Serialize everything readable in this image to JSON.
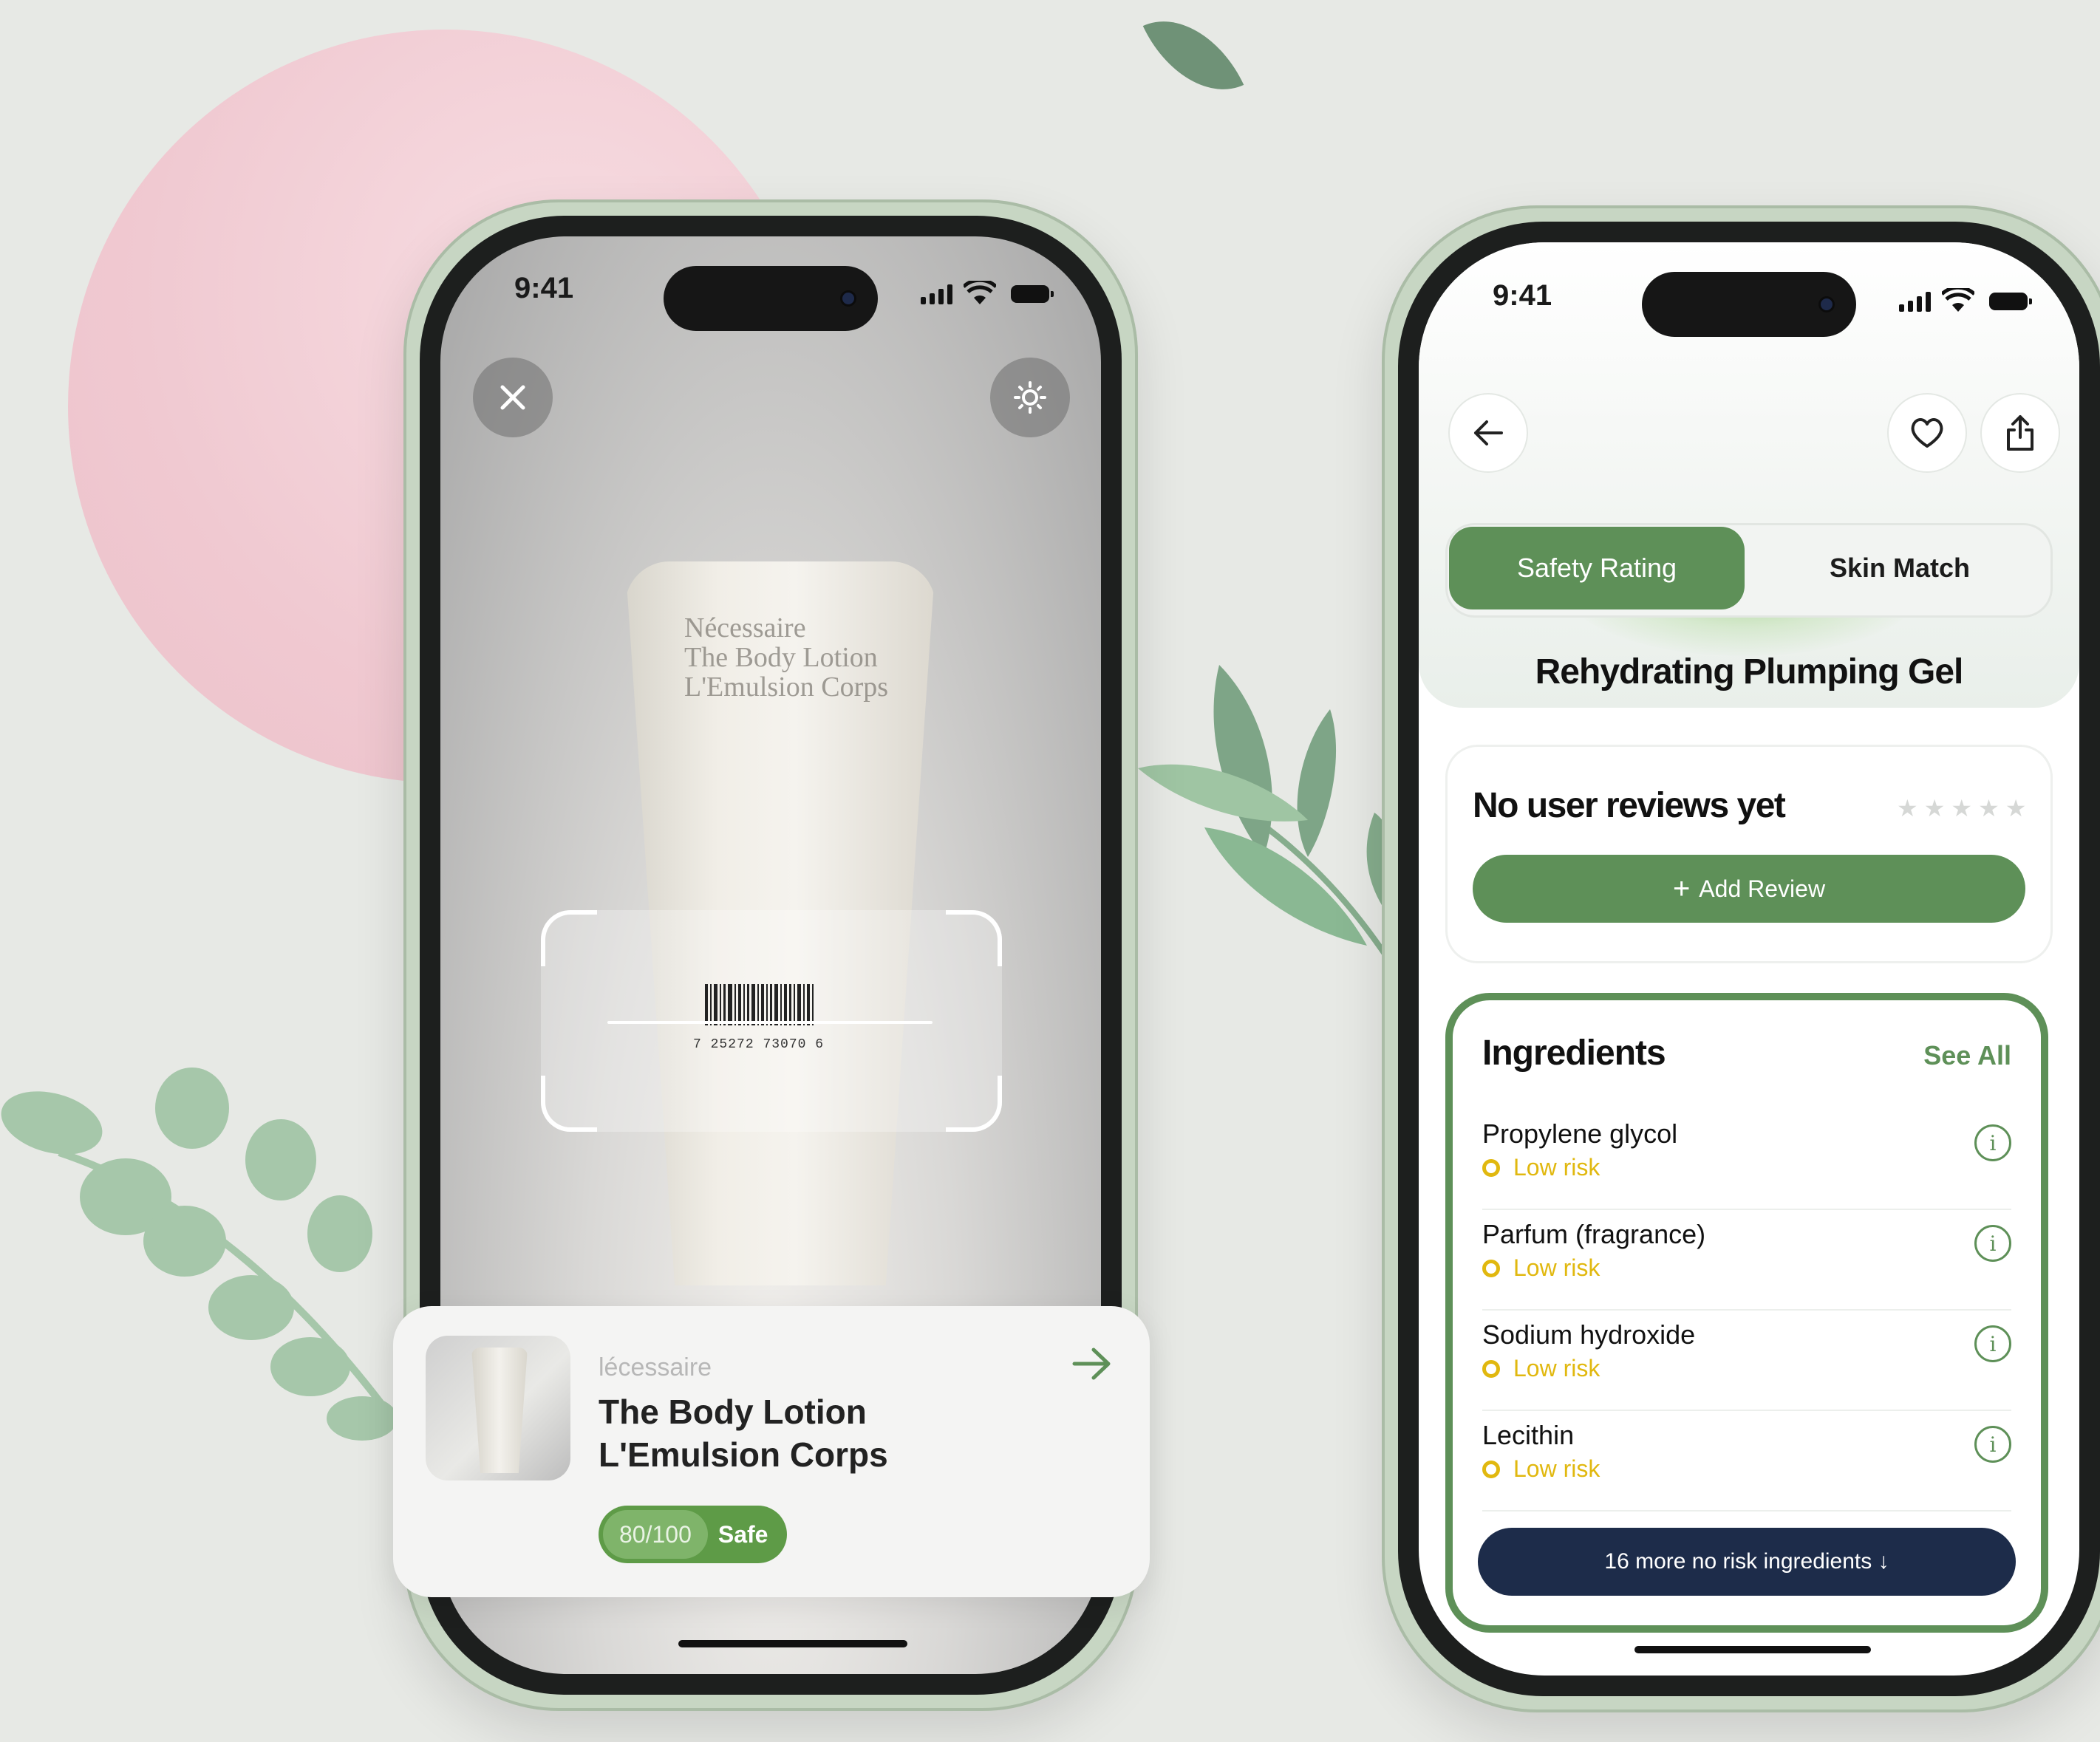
{
  "colors": {
    "accent": "#5e9058",
    "score_green": "#5e9b47",
    "risk_yellow": "#e1b80f",
    "navy": "#1d2c4a",
    "background": "#e7e9e5"
  },
  "scanner": {
    "status_time": "9:41",
    "close_icon": "close-icon",
    "flash_icon": "brightness-icon",
    "tube_brand_text": "Nécessaire",
    "tube_text_1": "The Body Lotion",
    "tube_text_2": "L'Emulsion Corps",
    "barcode_digits": [
      "7",
      "25272",
      "73070",
      "6"
    ],
    "result": {
      "brand": "lécessaire",
      "name_line1": "The Body Lotion",
      "name_line2": "L'Emulsion Corps",
      "score": "80/100",
      "verdict": "Safe",
      "score_fraction": 0.8
    }
  },
  "detail": {
    "status_time": "9:41",
    "tabs": [
      "Safety Rating",
      "Skin Match"
    ],
    "active_tab": 0,
    "product_title": "Rehydrating Plumping Gel",
    "reviews": {
      "title": "No user reviews yet",
      "rating": 0,
      "max_rating": 5,
      "add_label": "Add Review"
    },
    "ingredients": {
      "title": "Ingredients",
      "see_all": "See All",
      "items": [
        {
          "name": "Propylene glycol",
          "risk": "Low risk"
        },
        {
          "name": "Parfum (fragrance)",
          "risk": "Low risk"
        },
        {
          "name": "Sodium hydroxide",
          "risk": "Low risk"
        },
        {
          "name": "Lecithin",
          "risk": "Low risk"
        }
      ],
      "more_label": "16 more no risk ingredients ↓"
    }
  }
}
